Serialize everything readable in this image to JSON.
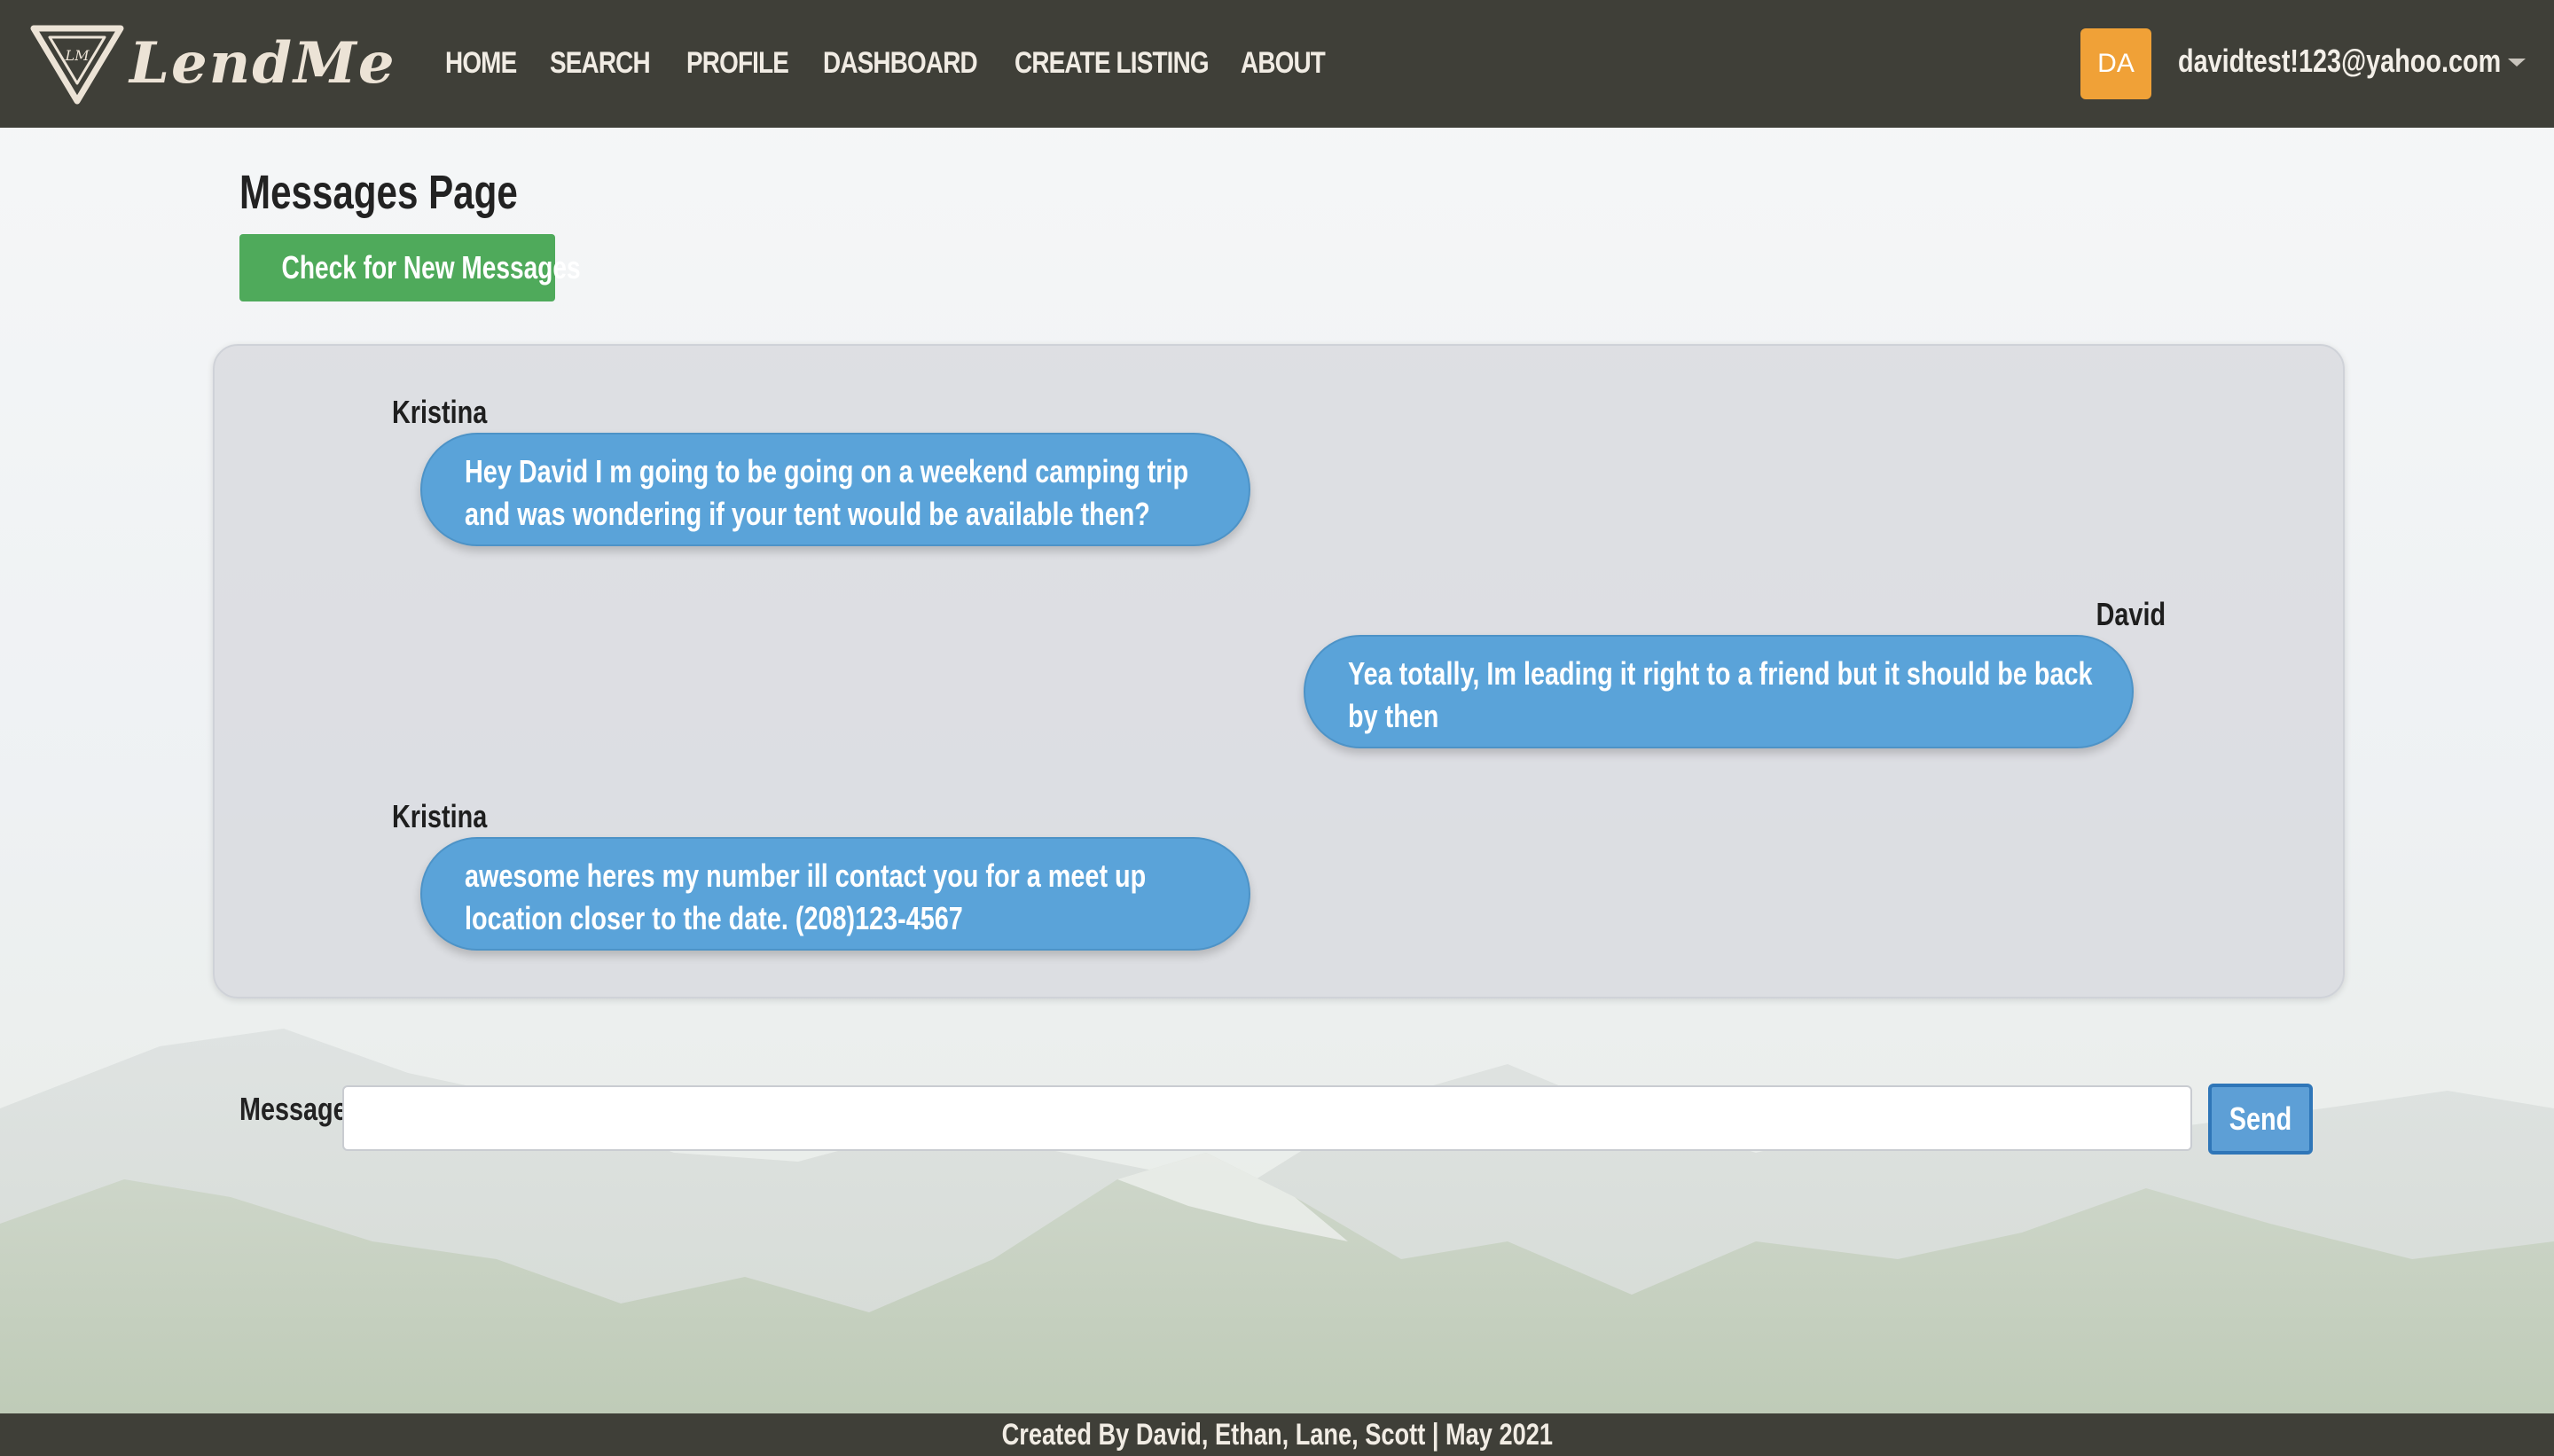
{
  "brand": {
    "name": "LendMe",
    "mark_text": "LM"
  },
  "nav": {
    "items": [
      {
        "label": "HOME"
      },
      {
        "label": "SEARCH"
      },
      {
        "label": "PROFILE"
      },
      {
        "label": "DASHBOARD"
      },
      {
        "label": "CREATE LISTING"
      },
      {
        "label": "ABOUT"
      }
    ]
  },
  "user": {
    "initials": "DA",
    "email": "davidtest!123@yahoo.com"
  },
  "page": {
    "title": "Messages Page",
    "check_button": "Check for New Messages"
  },
  "messages": [
    {
      "sender": "Kristina",
      "text": "Hey David I m going to be going on a weekend camping trip and was wondering if your tent would be available then?"
    },
    {
      "sender": "David",
      "text": "Yea totally, Im leading it right to a friend but it should be back by then"
    },
    {
      "sender": "Kristina",
      "text": "awesome heres my number ill contact you for a meet up location closer to the date. (208)123-4567"
    }
  ],
  "compose": {
    "label": "Message",
    "placeholder": "",
    "value": "",
    "send_label": "Send"
  },
  "footer": {
    "text": "Created By David, Ethan, Lane, Scott | May 2021"
  },
  "colors": {
    "navbar": "#3f3f38",
    "avatar": "#f0a137",
    "check_button": "#4faa5b",
    "bubble": "#5aa3d9",
    "send_button": "#5d9fd6"
  }
}
